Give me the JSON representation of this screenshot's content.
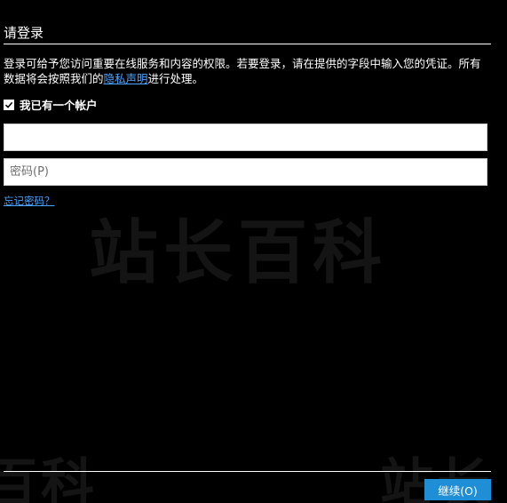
{
  "dialog": {
    "title": "请登录",
    "description_prefix": "登录可给予您访问重要在线服务和内容的权限。若要登录，请在提供的字段中输入您的凭证。所有数据将会按照我们的",
    "privacy_link": "隐私声明",
    "description_suffix": "进行处理。"
  },
  "account_checkbox": {
    "label": "我已有一个帐户",
    "checked": true
  },
  "fields": {
    "username_value": "",
    "password_placeholder": "密码(P)"
  },
  "forgot_password": "忘记密码？",
  "continue_button": "继续(O)",
  "watermark": {
    "center": "站长百科",
    "bottom_left": "百科",
    "bottom_right": "站长"
  },
  "colors": {
    "background": "#000000",
    "text": "#ffffff",
    "link": "#4aa3ff",
    "button": "#1e8ed6"
  }
}
